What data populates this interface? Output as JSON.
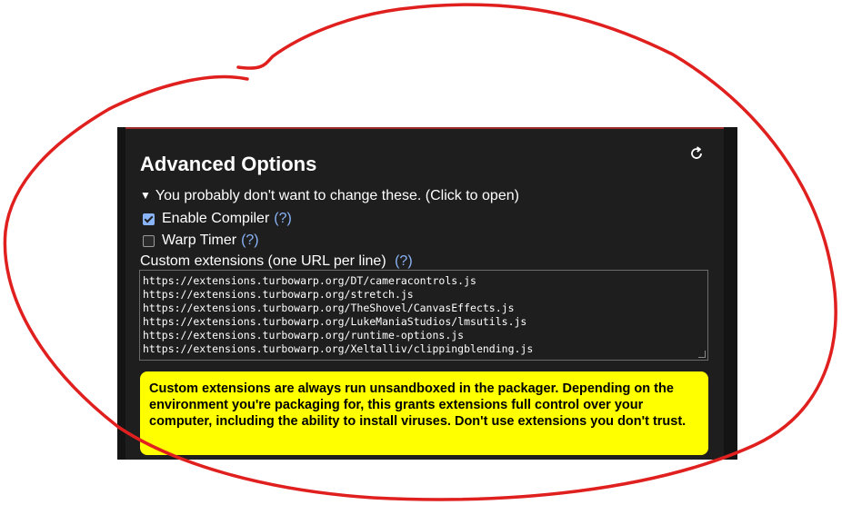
{
  "section": {
    "title": "Advanced Options",
    "summary": "You probably don't want to change these. (Click to open)"
  },
  "options": {
    "enable_compiler": {
      "label": "Enable Compiler",
      "checked": true,
      "help": "(?)"
    },
    "warp_timer": {
      "label": "Warp Timer",
      "checked": false,
      "help": "(?)"
    }
  },
  "custom_extensions": {
    "label": "Custom extensions (one URL per line)",
    "help": "(?)",
    "urls": [
      "https://extensions.turbowarp.org/DT/cameracontrols.js",
      "https://extensions.turbowarp.org/stretch.js",
      "https://extensions.turbowarp.org/TheShovel/CanvasEffects.js",
      "https://extensions.turbowarp.org/LukeManiaStudios/lmsutils.js",
      "https://extensions.turbowarp.org/runtime-options.js",
      "https://extensions.turbowarp.org/Xeltalliv/clippingblending.js"
    ]
  },
  "warning": {
    "text": "Custom extensions are always run unsandboxed in the packager. Depending on the environment you're packaging for, this grants extensions full control over your computer, including the ability to install viruses. Don't use extensions you don't trust."
  },
  "colors": {
    "panel_bg": "#1e1e1e",
    "link": "#8ab4f8",
    "warning_bg": "#ffff00",
    "annotation": "#e0201e"
  },
  "icons": {
    "reset": "reset-icon",
    "disclosure": "triangle-down-icon"
  }
}
